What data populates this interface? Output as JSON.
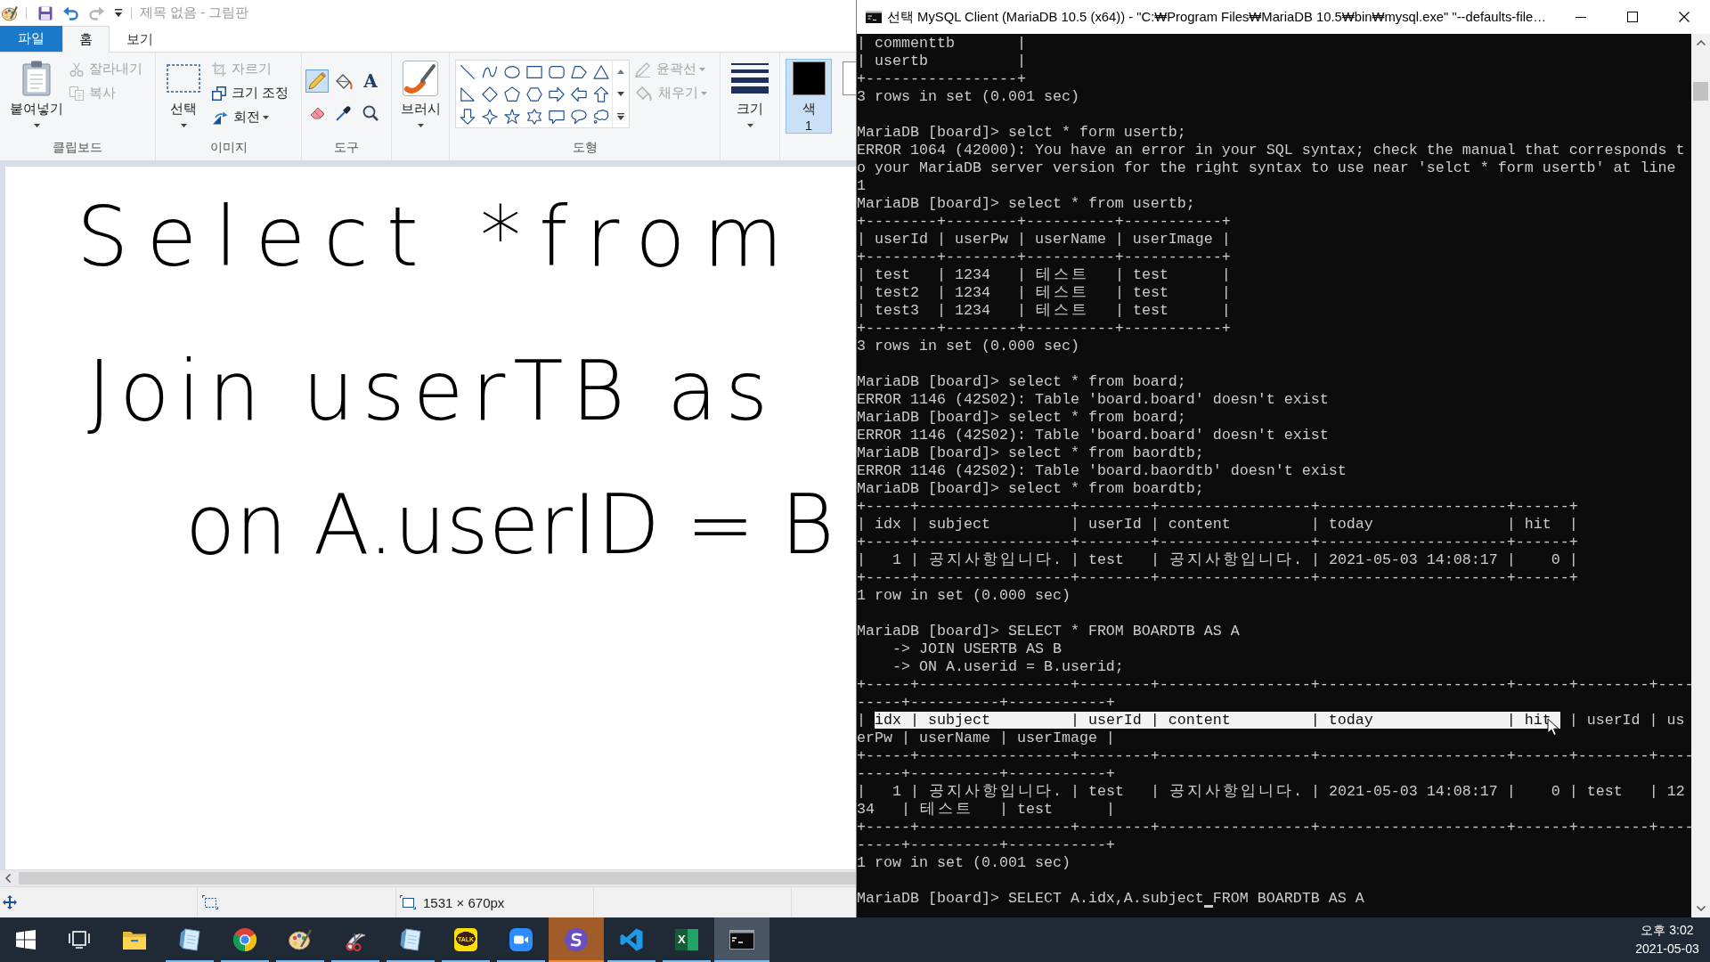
{
  "paint": {
    "title": "제목 없음 - 그림판",
    "active": false,
    "quick_access": [
      {
        "kind": "save",
        "disabled": false
      },
      {
        "kind": "undo",
        "disabled": false
      },
      {
        "kind": "redo",
        "disabled": true
      },
      {
        "kind": "customize",
        "disabled": false
      }
    ],
    "tabs": [
      {
        "kind": "file",
        "label": "파일",
        "selected": false
      },
      {
        "kind": "tab",
        "label": "홈",
        "selected": true
      },
      {
        "kind": "tab",
        "label": "보기",
        "selected": false
      }
    ],
    "ribbon": {
      "clipboard": {
        "label": "클립보드",
        "paste": "붙여넣기",
        "buttons": [
          {
            "kind": "cut",
            "label": "잘라내기",
            "disabled": true,
            "dropdown": false
          },
          {
            "kind": "copy",
            "label": "복사",
            "disabled": true,
            "dropdown": false
          }
        ]
      },
      "image": {
        "label": "이미지",
        "select": "선택",
        "buttons": [
          {
            "kind": "crop",
            "label": "자르기",
            "disabled": true,
            "dropdown": false
          },
          {
            "kind": "resize",
            "label": "크기 조정",
            "disabled": false,
            "dropdown": false
          },
          {
            "kind": "rotate",
            "label": "회전",
            "disabled": false,
            "dropdown": true
          }
        ]
      },
      "tools": {
        "label": "도구",
        "items": [
          {
            "kind": "pencil",
            "selected": true
          },
          {
            "kind": "fill",
            "selected": false
          },
          {
            "kind": "text",
            "glyph": "A",
            "selected": false
          },
          {
            "kind": "eraser",
            "selected": false
          },
          {
            "kind": "picker",
            "selected": false
          },
          {
            "kind": "magnifier",
            "selected": false
          }
        ]
      },
      "brushes": {
        "label": "브러시"
      },
      "shapes": {
        "label": "도형",
        "items": [
          {
            "kind": "line"
          },
          {
            "kind": "curve"
          },
          {
            "kind": "oval"
          },
          {
            "kind": "rectangle"
          },
          {
            "kind": "rounded-rectangle"
          },
          {
            "kind": "polygon"
          },
          {
            "kind": "triangle"
          },
          {
            "kind": "right-triangle"
          },
          {
            "kind": "diamond"
          },
          {
            "kind": "pentagon"
          },
          {
            "kind": "hexagon"
          },
          {
            "kind": "right-arrow"
          },
          {
            "kind": "left-arrow"
          },
          {
            "kind": "up-arrow"
          },
          {
            "kind": "down-arrow"
          },
          {
            "kind": "four-point-star"
          },
          {
            "kind": "five-point-star"
          },
          {
            "kind": "six-point-star"
          },
          {
            "kind": "rectangle-callout"
          },
          {
            "kind": "oval-callout"
          },
          {
            "kind": "cloud-callout"
          }
        ],
        "options": [
          {
            "kind": "outline",
            "label": "윤곽선",
            "disabled": true,
            "dropdown": true
          },
          {
            "kind": "fill",
            "label": "채우기",
            "disabled": true,
            "dropdown": true
          }
        ]
      },
      "size": {
        "label": "크기"
      },
      "colors": [
        {
          "kind": "primary",
          "label": "색",
          "number": "1",
          "color": "#000000",
          "selected": true
        },
        {
          "kind": "secondary",
          "color": "#ffffff",
          "selected": false
        }
      ]
    },
    "canvas": {
      "handwriting": [
        "Select *from",
        "Join userTB as",
        "on A.userID = B"
      ]
    },
    "status_bar": {
      "canvas_size": "1531 × 670px"
    }
  },
  "console": {
    "title": "선택 MySQL Client (MariaDB 10.5 (x64)) - \"C:₩Program Files₩MariaDB 10.5₩bin₩mysql.exe\"  \"--defaults-file…",
    "active": true,
    "lines": [
      {
        "kind": "text",
        "text": "| commenttb       |"
      },
      {
        "kind": "text",
        "text": "| usertb          |"
      },
      {
        "kind": "text",
        "text": "+-----------------+"
      },
      {
        "kind": "text",
        "text": "3 rows in set (0.001 sec)"
      },
      {
        "kind": "blank"
      },
      {
        "kind": "text",
        "text": "MariaDB [board]> selct * form usertb;"
      },
      {
        "kind": "text",
        "text": "ERROR 1064 (42000): You have an error in your SQL syntax; check the manual that corresponds t"
      },
      {
        "kind": "text",
        "text": "o your MariaDB server version for the right syntax to use near 'selct * form usertb' at line"
      },
      {
        "kind": "text",
        "text": "1"
      },
      {
        "kind": "text",
        "text": "MariaDB [board]> select * from usertb;"
      },
      {
        "kind": "text",
        "text": "+--------+--------+----------+-----------+"
      },
      {
        "kind": "text",
        "text": "| userId | userPw | userName | userImage |"
      },
      {
        "kind": "text",
        "text": "+--------+--------+----------+-----------+"
      },
      {
        "kind": "text",
        "text": "| test   | 1234   | 테스트   | test      |"
      },
      {
        "kind": "text",
        "text": "| test2  | 1234   | 테스트   | test      |"
      },
      {
        "kind": "text",
        "text": "| test3  | 1234   | 테스트   | test      |"
      },
      {
        "kind": "text",
        "text": "+--------+--------+----------+-----------+"
      },
      {
        "kind": "text",
        "text": "3 rows in set (0.000 sec)"
      },
      {
        "kind": "blank"
      },
      {
        "kind": "text",
        "text": "MariaDB [board]> select * from board;"
      },
      {
        "kind": "text",
        "text": "ERROR 1146 (42S02): Table 'board.board' doesn't exist"
      },
      {
        "kind": "text",
        "text": "MariaDB [board]> select * from board;"
      },
      {
        "kind": "text",
        "text": "ERROR 1146 (42S02): Table 'board.board' doesn't exist"
      },
      {
        "kind": "text",
        "text": "MariaDB [board]> select * from baordtb;"
      },
      {
        "kind": "text",
        "text": "ERROR 1146 (42S02): Table 'board.baordtb' doesn't exist"
      },
      {
        "kind": "text",
        "text": "MariaDB [board]> select * from boardtb;"
      },
      {
        "kind": "text",
        "text": "+-----+-----------------+--------+-----------------+---------------------+------+"
      },
      {
        "kind": "text",
        "text": "| idx | subject         | userId | content         | today               | hit  |"
      },
      {
        "kind": "text",
        "text": "+-----+-----------------+--------+-----------------+---------------------+------+"
      },
      {
        "kind": "text",
        "text": "|   1 | 공지사항입니다. | test   | 공지사항입니다. | 2021-05-03 14:08:17 |    0 |"
      },
      {
        "kind": "text",
        "text": "+-----+-----------------+--------+-----------------+---------------------+------+"
      },
      {
        "kind": "text",
        "text": "1 row in set (0.000 sec)"
      },
      {
        "kind": "blank"
      },
      {
        "kind": "text",
        "text": "MariaDB [board]> SELECT * FROM BOARDTB AS A"
      },
      {
        "kind": "text",
        "text": "    -> JOIN USERTB AS B"
      },
      {
        "kind": "text",
        "text": "    -> ON A.userid = B.userid;"
      },
      {
        "kind": "text",
        "text": "+-----+-----------------+--------+-----------------+---------------------+------+--------+----"
      },
      {
        "kind": "text",
        "text": "-----+----------+-----------+"
      },
      {
        "kind": "selection",
        "segments": [
          {
            "text": "| ",
            "selected": false
          },
          {
            "text": "idx | subject         | userId | content         | today               | hit ",
            "selected": true
          },
          {
            "text": " | userId | us",
            "selected": false
          }
        ]
      },
      {
        "kind": "text",
        "text": "erPw | userName | userImage |"
      },
      {
        "kind": "text",
        "text": "+-----+-----------------+--------+-----------------+---------------------+------+--------+----"
      },
      {
        "kind": "text",
        "text": "-----+----------+-----------+"
      },
      {
        "kind": "text",
        "text": "|   1 | 공지사항입니다. | test   | 공지사항입니다. | 2021-05-03 14:08:17 |    0 | test   | 12"
      },
      {
        "kind": "text",
        "text": "34   | 테스트   | test      |"
      },
      {
        "kind": "text",
        "text": "+-----+-----------------+--------+-----------------+---------------------+------+--------+----"
      },
      {
        "kind": "text",
        "text": "-----+----------+-----------+"
      },
      {
        "kind": "text",
        "text": "1 row in set (0.001 sec)"
      },
      {
        "kind": "blank"
      },
      {
        "kind": "prompt",
        "text": "MariaDB [board]> SELECT A.idx,A.subject",
        "after_cursor": "FROM BOARDTB AS A"
      }
    ]
  },
  "taskbar": {
    "items": [
      {
        "kind": "start",
        "running": false,
        "selected": false,
        "attention": false
      },
      {
        "kind": "task-view",
        "running": false,
        "selected": false,
        "attention": false
      },
      {
        "kind": "folder",
        "running": false,
        "selected": false,
        "attention": false
      },
      {
        "kind": "notepad",
        "running": true,
        "selected": false,
        "attention": false
      },
      {
        "kind": "browser",
        "running": true,
        "selected": false,
        "attention": false
      },
      {
        "kind": "paint",
        "running": true,
        "selected": false,
        "attention": false
      },
      {
        "kind": "snipping",
        "running": true,
        "selected": false,
        "attention": false
      },
      {
        "kind": "notepad",
        "running": true,
        "selected": false,
        "attention": false
      },
      {
        "kind": "chat",
        "logo_text": "TALK",
        "running": true,
        "selected": false,
        "attention": false
      },
      {
        "kind": "video",
        "running": true,
        "selected": false,
        "attention": false
      },
      {
        "kind": "swirl",
        "running": true,
        "selected": false,
        "attention": true
      },
      {
        "kind": "code",
        "running": true,
        "selected": false,
        "attention": false
      },
      {
        "kind": "spreadsheet",
        "logo_text": "X",
        "running": true,
        "selected": false,
        "attention": false
      },
      {
        "kind": "terminal",
        "running": true,
        "selected": true,
        "attention": false
      }
    ],
    "time": "오후 3:02",
    "date": "2021-05-03"
  }
}
